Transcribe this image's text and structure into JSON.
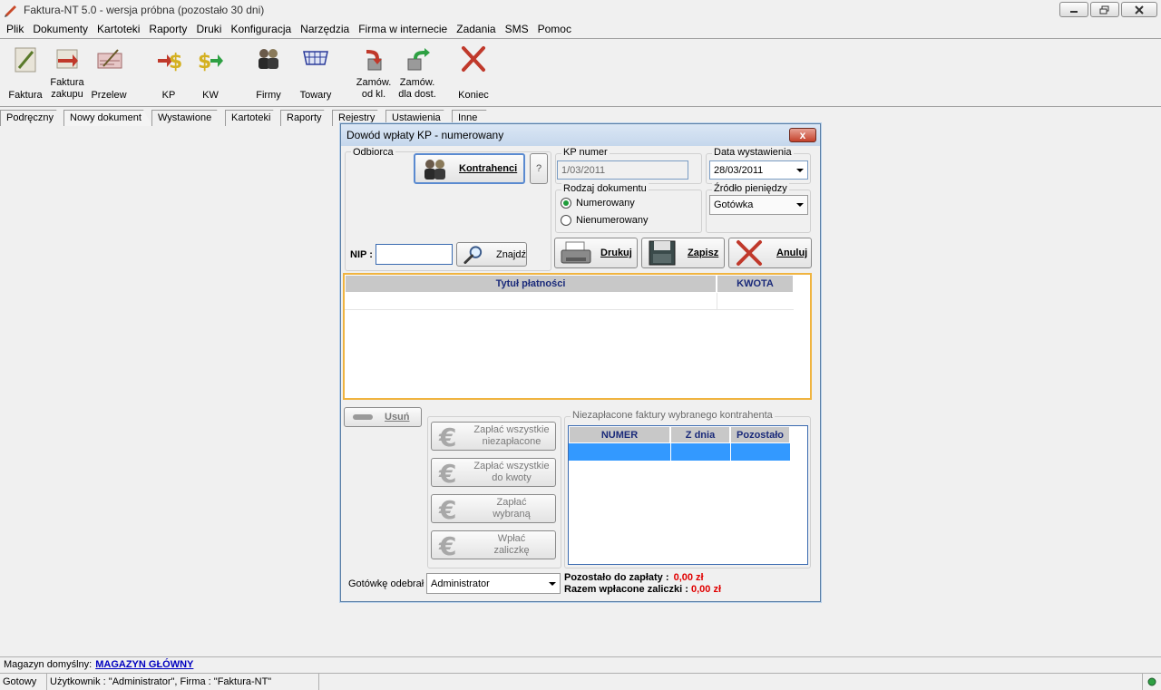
{
  "window": {
    "title": "Faktura-NT 5.0 - wersja próbna (pozostało 30 dni)"
  },
  "menu": [
    "Plik",
    "Dokumenty",
    "Kartoteki",
    "Raporty",
    "Druki",
    "Konfiguracja",
    "Narzędzia",
    "Firma w internecie",
    "Zadania",
    "SMS",
    "Pomoc"
  ],
  "toolbar": {
    "faktura": "Faktura",
    "faktura_zakupu_1": "Faktura",
    "faktura_zakupu_2": "zakupu",
    "przelew": "Przelew",
    "kp": "KP",
    "kw": "KW",
    "firmy": "Firmy",
    "towary": "Towary",
    "zamow_odkl_1": "Zamów.",
    "zamow_odkl_2": "od kl.",
    "zamow_dost_1": "Zamów.",
    "zamow_dost_2": "dla dost.",
    "koniec": "Koniec"
  },
  "tabs": [
    "Podręczny",
    "Nowy dokument",
    "Wystawione",
    "Kartoteki",
    "Raporty",
    "Rejestry",
    "Ustawienia",
    "Inne"
  ],
  "dialog": {
    "title": "Dowód wpłaty KP - numerowany",
    "close": "x",
    "odbiorca_label": "Odbiorca",
    "kontrahenci": "Kontrahenci",
    "help": "?",
    "nip_label": "NIP :",
    "nip_value": "",
    "znajdz": "Znajdź",
    "kp_numer_label": "KP numer",
    "kp_numer_value": "1/03/2011",
    "data_label": "Data wystawienia",
    "data_value": "28/03/2011",
    "rodzaj_label": "Rodzaj dokumentu",
    "numerowany": "Numerowany",
    "nienumerowany": "Nienumerowany",
    "zrodlo_label": "Źródło pieniędzy",
    "zrodlo_value": "Gotówka",
    "drukuj": "Drukuj",
    "zapisz": "Zapisz",
    "anuluj": "Anuluj",
    "grid_col_tytul": "Tytuł płatności",
    "grid_col_kwota": "KWOTA",
    "usun": "Usuń",
    "zaplac_wszystkie_1": "Zapłać wszystkie",
    "zaplac_wszystkie_2": "niezapłacone",
    "zaplac_kwoty_1": "Zapłać wszystkie",
    "zaplac_kwoty_2": "do kwoty",
    "zaplac_wybrana_1": "Zapłać",
    "zaplac_wybrana_2": "wybraną",
    "wplac_zaliczke_1": "Wpłać",
    "wplac_zaliczke_2": "zaliczkę",
    "niezaplacone_label": "Niezapłacone faktury wybranego kontrahenta",
    "col_numer": "NUMER",
    "col_zdnia": "Z dnia",
    "col_pozostalo": "Pozostało",
    "gotowke_label": "Gotówkę odebrał",
    "gotowke_value": "Administrator",
    "pozostalo_label": "Pozostało do zapłaty :",
    "pozostalo_value": "0,00 zł",
    "razem_label": "Razem wpłacone zaliczki :",
    "razem_value": "0,00 zł"
  },
  "status": {
    "magazyn_label": "Magazyn domyślny:",
    "magazyn_value": "MAGAZYN GŁÓWNY",
    "gotowy": "Gotowy",
    "uzytkownik": "Użytkownik : \"Administrator\", Firma : \"Faktura-NT\""
  },
  "colors": {
    "accent_border": "#f0b440",
    "selected_row": "#3399ff",
    "grid_header": "#c8c8c8",
    "red_value": "#e00000"
  }
}
